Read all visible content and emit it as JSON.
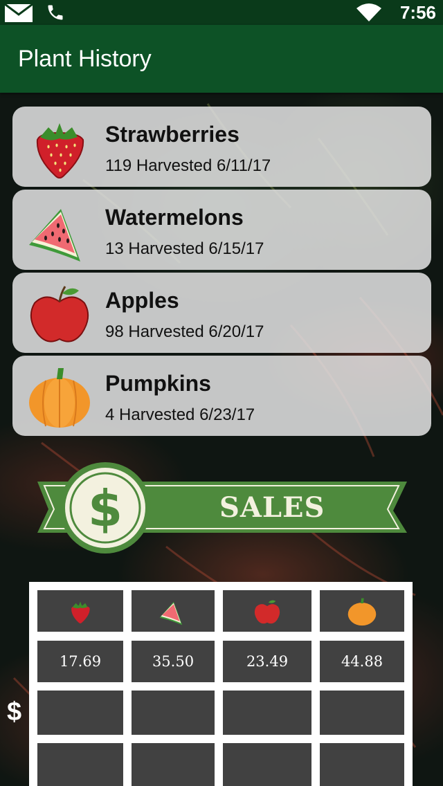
{
  "status_bar": {
    "time": "7:56"
  },
  "app_bar": {
    "title": "Plant History"
  },
  "plants": [
    {
      "name": "Strawberries",
      "detail": "119 Harvested 6/11/17",
      "icon": "strawberry-icon"
    },
    {
      "name": "Watermelons",
      "detail": "13 Harvested 6/15/17",
      "icon": "watermelon-icon"
    },
    {
      "name": "Apples",
      "detail": "98 Harvested 6/20/17",
      "icon": "apple-icon"
    },
    {
      "name": "Pumpkins",
      "detail": "4 Harvested 6/23/17",
      "icon": "pumpkin-icon"
    }
  ],
  "sales": {
    "banner_label": "SALES",
    "side_symbol": "$",
    "header_icons": [
      "strawberry-icon",
      "watermelon-icon",
      "apple-icon",
      "pumpkin-icon"
    ],
    "prices": [
      "17.69",
      "35.50",
      "23.49",
      "44.88"
    ]
  },
  "colors": {
    "status_bar": "#0a3a1a",
    "app_bar": "#0d5226",
    "banner_green": "#4e8a3d",
    "card_bg": "#e1e1e1"
  }
}
